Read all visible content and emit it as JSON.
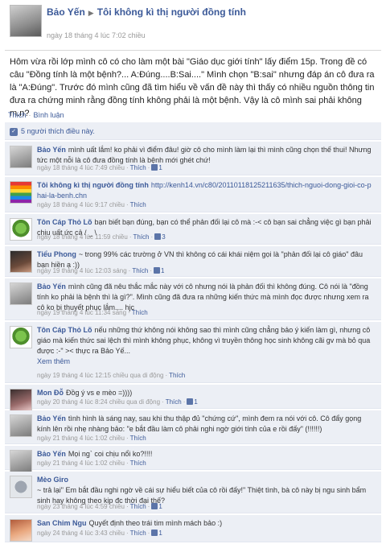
{
  "post": {
    "author": "Bảo Yến",
    "target": "Tôi không kì thị người đồng tính",
    "timestamp": "ngày 18 tháng 4 lúc 7:02 chiều",
    "body": "Hôm vừa rồi lớp mình cô có cho làm một bài \"Giáo dục giới tính\" lấy điểm 15p. Trong đề có câu \"Đồng tính là một bệnh?... A:Đúng....B:Sai....\" Mình chọn \"B:sai\" nhưng đáp án cô đưa ra là \"A:Đúng\". Trước đó mình cũng đã tìm hiểu về vấn đề này thì thấy có nhiều nguồn thông tin đưa ra chứng minh rằng đồng tính không phải là một bệnh. Vậy là cô mình sai phải không m.n?",
    "like_action": "Thích",
    "comment_action": "Bình luận"
  },
  "likes": {
    "text": "5 người thích điều này.",
    "icon": "thumbs-up-icon"
  },
  "comments": [
    {
      "name": "Bảo Yến",
      "text": "mình uất lắm! ko phải vì điểm đâu! giờ cô cho mình làm lại thì mình cũng chọn thế thui! Nhưng tức một nỗi là cô đưa đồng tính là bệnh mới ghét chứ!",
      "time": "ngày 18 tháng 4 lúc 7:49 chiều",
      "like": "Thích",
      "count": "1",
      "avatar": "emma"
    },
    {
      "name": "Tôi không kì thị người đồng tính",
      "text": "http://kenh14.vn/c80/20110118125211635/thich-nguoi-dong-gioi-co-phai-la-benh.chn",
      "time": "ngày 18 tháng 4 lúc 9:17 chiều",
      "like": "Thích",
      "count": "",
      "avatar": "rainbow"
    },
    {
      "name": "Tôn Cáp Thỏ Lõ",
      "text": "bạn biết bạn đúng, bạn có thể phản đối lại cô mà :-< cô bạn sai chẳng việc gì bạn phải chịu uất ức cả / _ \\",
      "time": "ngày 18 tháng 4 lúc 11:59 chiều",
      "like": "Thích",
      "count": "3",
      "avatar": "turtle"
    },
    {
      "name": "Tiểu Phong",
      "text": "~ trong 99% các trường ở VN thì không có cái khái niệm gọi là \"phản đối lại cô giáo\" đâu bạn hiền ạ :))",
      "time": "ngày 19 tháng 4 lúc 12:03 sáng",
      "like": "Thích",
      "count": "1",
      "avatar": "girl"
    },
    {
      "name": "Bảo Yến",
      "text": "mình cũng đã nêu thắc mắc này với cô nhưng nói là phản đối thì không đúng. Cô nói là \"đồng tính ko phải là bệnh thì là gì?\". Mình cũng đã đưa ra những kiến thức mà mình đọc được nhưng xem ra cô ko bị thuyết phục lắm.... hjc",
      "time": "ngày 19 tháng 4 lúc 11:34 sáng",
      "like": "Thích",
      "count": "",
      "avatar": "emma"
    },
    {
      "name": "Tôn Cáp Thỏ Lõ",
      "text": "nếu những thứ không nói không sao thì mình cũng chẳng bảo ý kiến làm gì, nhưng cô giáo mà kiến thức sai lệch thì mình không phục, không vì truyền thông học sinh không cãi gv mà bỏ qua được :-\" >< thực ra Bảo Yế...",
      "more": "Xem thêm",
      "time": "ngày 19 tháng 4 lúc 12:15 chiều qua di động",
      "like": "Thích",
      "count": "",
      "avatar": "turtle"
    },
    {
      "name": "Mon Đỗ",
      "text": "Đồg ý vs e mèo =))))",
      "time": "ngày 20 tháng 4 lúc 8:24 chiều qua di động",
      "like": "Thích",
      "count": "1",
      "avatar": "mon"
    },
    {
      "name": "Bảo Yến",
      "text": "tình hình là sáng nay, sau khi thu thập đủ \"chứng cứ\", mình đem ra nói với cô. Cô đẩy gọng kính lên rồi nhẹ nhàng bảo: \"e bắt đầu làm cô phải nghi ngờ giới tính của e rồi đấy\" (!!!!!!)",
      "time": "ngày 21 tháng 4 lúc 1:02 chiều",
      "like": "Thích",
      "count": "",
      "avatar": "emma"
    },
    {
      "name": "Bảo Yến",
      "text": "Mọi ng` coi chịu nổi ko?!!!!",
      "time": "ngày 21 tháng 4 lúc 1:02 chiều",
      "like": "Thích",
      "count": "",
      "avatar": "emma"
    },
    {
      "name": "Mèo Giro",
      "text": "~ trả lại\" Em bắt đầu nghi ngờ về cái sự hiểu biết của cô rồi đấy!\" Thiệt tình, bà cô này bị ngu sinh bẩm sinh hay không theo kịp đc thời đại thế?",
      "time": "ngày 23 tháng 4 lúc 4:59 chiều",
      "like": "Thích",
      "count": "1",
      "avatar": "cat"
    },
    {
      "name": "San Chim Ngu",
      "text": "Quyết định theo trái tim mình mách bảo :)",
      "time": "ngày 24 tháng 4 lúc 3:43 chiều",
      "like": "Thích",
      "count": "1",
      "avatar": "san"
    }
  ]
}
